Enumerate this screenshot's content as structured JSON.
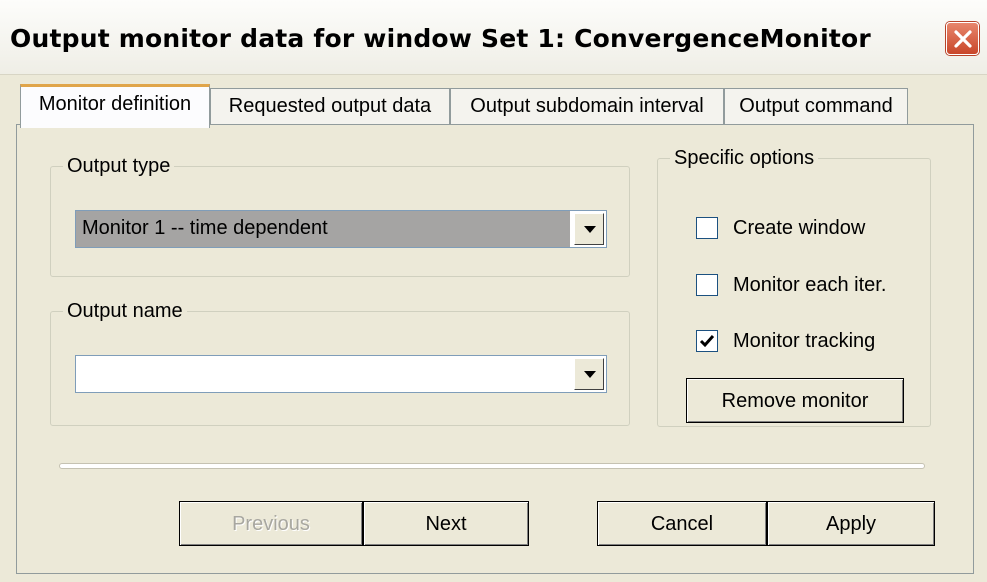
{
  "window": {
    "title": "Output monitor data for window Set 1: ConvergenceMonitor"
  },
  "tabs": [
    {
      "label": "Monitor definition",
      "active": true
    },
    {
      "label": "Requested output data",
      "active": false
    },
    {
      "label": "Output subdomain interval",
      "active": false
    },
    {
      "label": "Output command",
      "active": false
    }
  ],
  "output_type": {
    "legend": "Output type",
    "selected": "Monitor 1 -- time dependent"
  },
  "output_name": {
    "legend": "Output name",
    "selected": ""
  },
  "specific_options": {
    "legend": "Specific options",
    "checkboxes": [
      {
        "label": "Create window",
        "checked": false
      },
      {
        "label": "Monitor each iter.",
        "checked": false
      },
      {
        "label": "Monitor tracking",
        "checked": true
      }
    ],
    "remove_button": "Remove monitor"
  },
  "progress": {
    "value": 0
  },
  "buttons": {
    "previous": "Previous",
    "next": "Next",
    "cancel": "Cancel",
    "apply": "Apply"
  },
  "icons": {
    "close": "close-icon",
    "dropdown": "chevron-down-icon",
    "check": "checkmark-icon"
  },
  "colors": {
    "close_button": "#d0502f",
    "tab_highlight": "#e0a54a",
    "selection": "#a5a4a3"
  }
}
